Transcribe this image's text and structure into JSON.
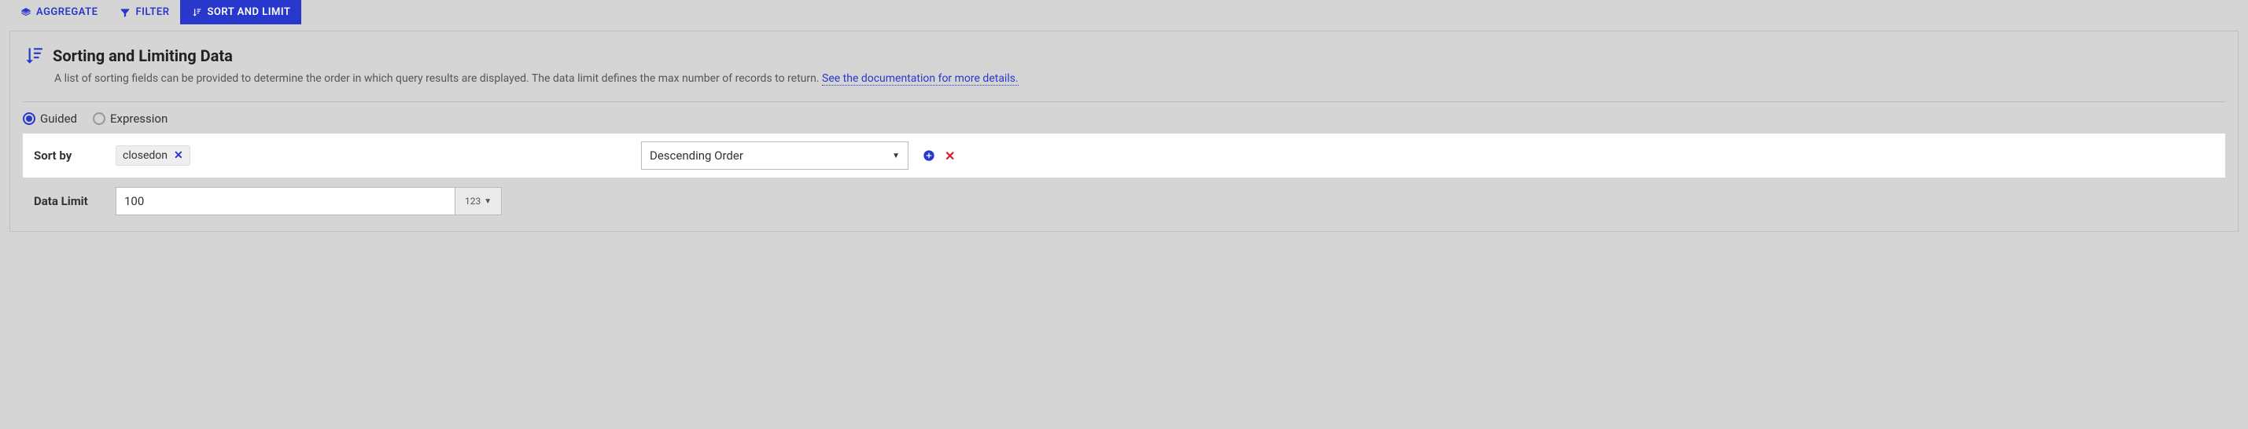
{
  "tabs": {
    "aggregate": "AGGREGATE",
    "filter": "FILTER",
    "sortlimit": "SORT AND LIMIT"
  },
  "header": {
    "title": "Sorting and Limiting Data",
    "description_a": "A list of sorting fields can be provided to determine the order in which query results are displayed. The data limit defines the max number of records to return. ",
    "doc_link": "See the documentation for more details."
  },
  "mode": {
    "guided": "Guided",
    "expression": "Expression"
  },
  "sort": {
    "label": "Sort by",
    "chip": "closedon",
    "order": "Descending Order"
  },
  "limit": {
    "label": "Data Limit",
    "value": "100",
    "type": "123"
  }
}
